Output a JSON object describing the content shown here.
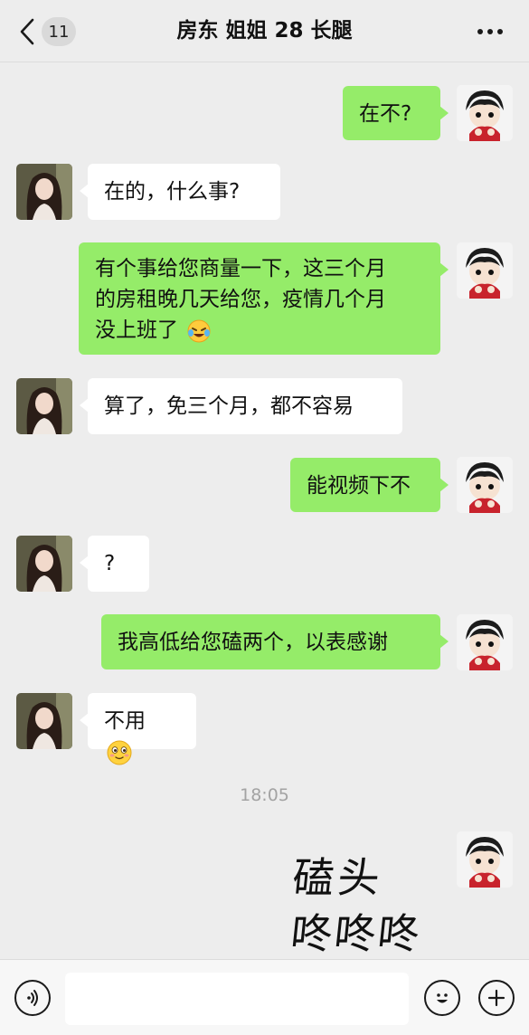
{
  "header": {
    "back_count": "11",
    "title": "房东 姐姐 28 长腿"
  },
  "messages": [
    {
      "side": "out",
      "text": "在不?"
    },
    {
      "side": "in",
      "text": "在的，什么事?"
    },
    {
      "side": "out",
      "lines": [
        "有个事给您商量一下，这三个月",
        "的房租晚几天给您，疫情几个月",
        "没上班了"
      ],
      "emoji": "crying-laughing-emoji"
    },
    {
      "side": "in",
      "text": "算了，免三个月，都不容易"
    },
    {
      "side": "out",
      "text": "能视频下不"
    },
    {
      "side": "in",
      "text": "?"
    },
    {
      "side": "out",
      "text": "我高低给您磕两个，以表感谢"
    },
    {
      "side": "in",
      "text": "不用",
      "emoji": "smiling-face-emoji"
    }
  ],
  "timestamp": "18:05",
  "sticker": {
    "lines": [
      "磕头",
      "咚咚咚"
    ]
  },
  "input": {
    "value": "",
    "placeholder": ""
  },
  "icons": {
    "back": "chevron-left-icon",
    "more": "more-dots-icon",
    "voice": "voice-icon",
    "emoji": "emoji-icon",
    "plus": "plus-icon"
  },
  "colors": {
    "background": "#ededed",
    "outgoing_bubble": "#95ec69",
    "incoming_bubble": "#ffffff"
  }
}
